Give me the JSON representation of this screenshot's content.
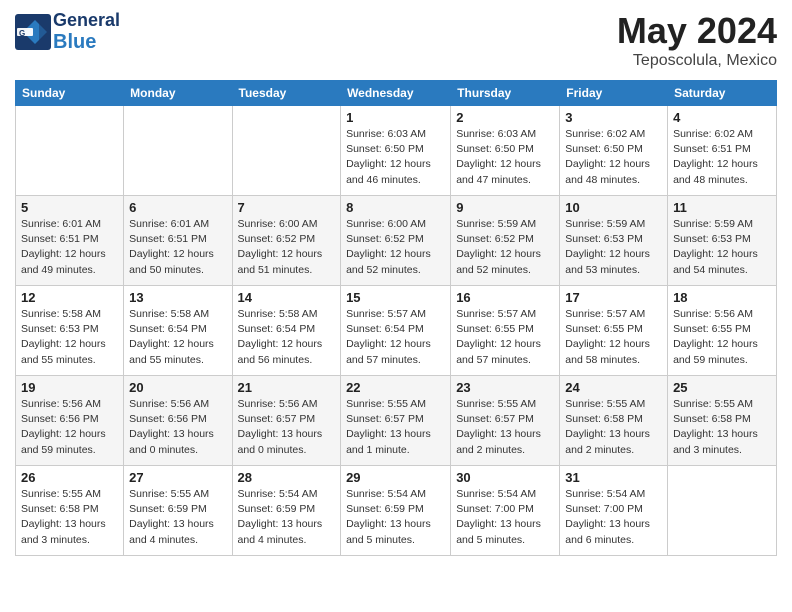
{
  "header": {
    "logo": {
      "general": "General",
      "blue": "Blue"
    },
    "month": "May 2024",
    "location": "Teposcolula, Mexico"
  },
  "weekdays": [
    "Sunday",
    "Monday",
    "Tuesday",
    "Wednesday",
    "Thursday",
    "Friday",
    "Saturday"
  ],
  "weeks": [
    [
      {
        "day": "",
        "info": ""
      },
      {
        "day": "",
        "info": ""
      },
      {
        "day": "",
        "info": ""
      },
      {
        "day": "1",
        "info": "Sunrise: 6:03 AM\nSunset: 6:50 PM\nDaylight: 12 hours\nand 46 minutes."
      },
      {
        "day": "2",
        "info": "Sunrise: 6:03 AM\nSunset: 6:50 PM\nDaylight: 12 hours\nand 47 minutes."
      },
      {
        "day": "3",
        "info": "Sunrise: 6:02 AM\nSunset: 6:50 PM\nDaylight: 12 hours\nand 48 minutes."
      },
      {
        "day": "4",
        "info": "Sunrise: 6:02 AM\nSunset: 6:51 PM\nDaylight: 12 hours\nand 48 minutes."
      }
    ],
    [
      {
        "day": "5",
        "info": "Sunrise: 6:01 AM\nSunset: 6:51 PM\nDaylight: 12 hours\nand 49 minutes."
      },
      {
        "day": "6",
        "info": "Sunrise: 6:01 AM\nSunset: 6:51 PM\nDaylight: 12 hours\nand 50 minutes."
      },
      {
        "day": "7",
        "info": "Sunrise: 6:00 AM\nSunset: 6:52 PM\nDaylight: 12 hours\nand 51 minutes."
      },
      {
        "day": "8",
        "info": "Sunrise: 6:00 AM\nSunset: 6:52 PM\nDaylight: 12 hours\nand 52 minutes."
      },
      {
        "day": "9",
        "info": "Sunrise: 5:59 AM\nSunset: 6:52 PM\nDaylight: 12 hours\nand 52 minutes."
      },
      {
        "day": "10",
        "info": "Sunrise: 5:59 AM\nSunset: 6:53 PM\nDaylight: 12 hours\nand 53 minutes."
      },
      {
        "day": "11",
        "info": "Sunrise: 5:59 AM\nSunset: 6:53 PM\nDaylight: 12 hours\nand 54 minutes."
      }
    ],
    [
      {
        "day": "12",
        "info": "Sunrise: 5:58 AM\nSunset: 6:53 PM\nDaylight: 12 hours\nand 55 minutes."
      },
      {
        "day": "13",
        "info": "Sunrise: 5:58 AM\nSunset: 6:54 PM\nDaylight: 12 hours\nand 55 minutes."
      },
      {
        "day": "14",
        "info": "Sunrise: 5:58 AM\nSunset: 6:54 PM\nDaylight: 12 hours\nand 56 minutes."
      },
      {
        "day": "15",
        "info": "Sunrise: 5:57 AM\nSunset: 6:54 PM\nDaylight: 12 hours\nand 57 minutes."
      },
      {
        "day": "16",
        "info": "Sunrise: 5:57 AM\nSunset: 6:55 PM\nDaylight: 12 hours\nand 57 minutes."
      },
      {
        "day": "17",
        "info": "Sunrise: 5:57 AM\nSunset: 6:55 PM\nDaylight: 12 hours\nand 58 minutes."
      },
      {
        "day": "18",
        "info": "Sunrise: 5:56 AM\nSunset: 6:55 PM\nDaylight: 12 hours\nand 59 minutes."
      }
    ],
    [
      {
        "day": "19",
        "info": "Sunrise: 5:56 AM\nSunset: 6:56 PM\nDaylight: 12 hours\nand 59 minutes."
      },
      {
        "day": "20",
        "info": "Sunrise: 5:56 AM\nSunset: 6:56 PM\nDaylight: 13 hours\nand 0 minutes."
      },
      {
        "day": "21",
        "info": "Sunrise: 5:56 AM\nSunset: 6:57 PM\nDaylight: 13 hours\nand 0 minutes."
      },
      {
        "day": "22",
        "info": "Sunrise: 5:55 AM\nSunset: 6:57 PM\nDaylight: 13 hours\nand 1 minute."
      },
      {
        "day": "23",
        "info": "Sunrise: 5:55 AM\nSunset: 6:57 PM\nDaylight: 13 hours\nand 2 minutes."
      },
      {
        "day": "24",
        "info": "Sunrise: 5:55 AM\nSunset: 6:58 PM\nDaylight: 13 hours\nand 2 minutes."
      },
      {
        "day": "25",
        "info": "Sunrise: 5:55 AM\nSunset: 6:58 PM\nDaylight: 13 hours\nand 3 minutes."
      }
    ],
    [
      {
        "day": "26",
        "info": "Sunrise: 5:55 AM\nSunset: 6:58 PM\nDaylight: 13 hours\nand 3 minutes."
      },
      {
        "day": "27",
        "info": "Sunrise: 5:55 AM\nSunset: 6:59 PM\nDaylight: 13 hours\nand 4 minutes."
      },
      {
        "day": "28",
        "info": "Sunrise: 5:54 AM\nSunset: 6:59 PM\nDaylight: 13 hours\nand 4 minutes."
      },
      {
        "day": "29",
        "info": "Sunrise: 5:54 AM\nSunset: 6:59 PM\nDaylight: 13 hours\nand 5 minutes."
      },
      {
        "day": "30",
        "info": "Sunrise: 5:54 AM\nSunset: 7:00 PM\nDaylight: 13 hours\nand 5 minutes."
      },
      {
        "day": "31",
        "info": "Sunrise: 5:54 AM\nSunset: 7:00 PM\nDaylight: 13 hours\nand 6 minutes."
      },
      {
        "day": "",
        "info": ""
      }
    ]
  ]
}
